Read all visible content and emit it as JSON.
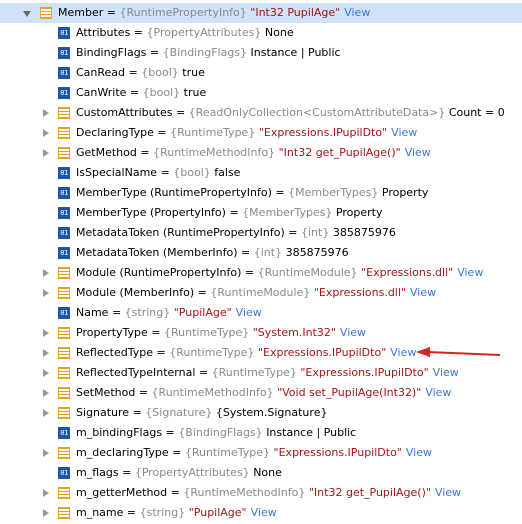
{
  "colors": {
    "selection": "#cfe2f7",
    "property_icon": "#e8a31c",
    "value_icon": "#1f55a8",
    "type_text": "#8a8a8a",
    "string_text": "#a31515",
    "view_link": "#3c78d8",
    "arrow": "#d62424"
  },
  "value_icon_text": "01",
  "equals": " = ",
  "rows": [
    {
      "level": 0,
      "expander": "expanded",
      "icon": "property-icon",
      "selected": true,
      "name": "Member",
      "type": "{RuntimePropertyInfo}",
      "value": "\"Int32 PupilAge\"",
      "value_kind": "string",
      "view": "View"
    },
    {
      "level": 1,
      "expander": "none",
      "icon": "value-icon",
      "name": "Attributes",
      "type": "{PropertyAttributes}",
      "value": "None",
      "value_kind": "plain",
      "view": ""
    },
    {
      "level": 1,
      "expander": "none",
      "icon": "value-icon",
      "name": "BindingFlags",
      "type": "{BindingFlags}",
      "value": "Instance | Public",
      "value_kind": "plain",
      "view": ""
    },
    {
      "level": 1,
      "expander": "none",
      "icon": "value-icon",
      "name": "CanRead",
      "type": "{bool}",
      "value": "true",
      "value_kind": "plain",
      "view": ""
    },
    {
      "level": 1,
      "expander": "none",
      "icon": "value-icon",
      "name": "CanWrite",
      "type": "{bool}",
      "value": "true",
      "value_kind": "plain",
      "view": ""
    },
    {
      "level": 1,
      "expander": "collapsed",
      "icon": "property-icon",
      "name": "CustomAttributes",
      "type": "{ReadOnlyCollection<CustomAttributeData>}",
      "value": "Count = 0",
      "value_kind": "plain",
      "view": ""
    },
    {
      "level": 1,
      "expander": "collapsed",
      "icon": "property-icon",
      "name": "DeclaringType",
      "type": "{RuntimeType}",
      "value": "\"Expressions.IPupilDto\"",
      "value_kind": "string",
      "view": "View"
    },
    {
      "level": 1,
      "expander": "collapsed",
      "icon": "property-icon",
      "name": "GetMethod",
      "type": "{RuntimeMethodInfo}",
      "value": "\"Int32 get_PupilAge()\"",
      "value_kind": "string",
      "view": "View"
    },
    {
      "level": 1,
      "expander": "none",
      "icon": "value-icon",
      "name": "IsSpecialName",
      "type": "{bool}",
      "value": "false",
      "value_kind": "plain",
      "view": ""
    },
    {
      "level": 1,
      "expander": "none",
      "icon": "value-icon",
      "name": "MemberType (RuntimePropertyInfo)",
      "type": "{MemberTypes}",
      "value": "Property",
      "value_kind": "plain",
      "view": ""
    },
    {
      "level": 1,
      "expander": "none",
      "icon": "value-icon",
      "name": "MemberType (PropertyInfo)",
      "type": "{MemberTypes}",
      "value": "Property",
      "value_kind": "plain",
      "view": ""
    },
    {
      "level": 1,
      "expander": "none",
      "icon": "value-icon",
      "name": "MetadataToken (RuntimePropertyInfo)",
      "type": "{int}",
      "value": "385875976",
      "value_kind": "plain",
      "view": ""
    },
    {
      "level": 1,
      "expander": "none",
      "icon": "value-icon",
      "name": "MetadataToken (MemberInfo)",
      "type": "{int}",
      "value": "385875976",
      "value_kind": "plain",
      "view": ""
    },
    {
      "level": 1,
      "expander": "collapsed",
      "icon": "property-icon",
      "name": "Module (RuntimePropertyInfo)",
      "type": "{RuntimeModule}",
      "value": "\"Expressions.dll\"",
      "value_kind": "string",
      "view": "View"
    },
    {
      "level": 1,
      "expander": "collapsed",
      "icon": "property-icon",
      "name": "Module (MemberInfo)",
      "type": "{RuntimeModule}",
      "value": "\"Expressions.dll\"",
      "value_kind": "string",
      "view": "View"
    },
    {
      "level": 1,
      "expander": "none",
      "icon": "value-icon",
      "name": "Name",
      "type": "{string}",
      "value": "\"PupilAge\"",
      "value_kind": "string",
      "view": "View"
    },
    {
      "level": 1,
      "expander": "collapsed",
      "icon": "property-icon",
      "name": "PropertyType",
      "type": "{RuntimeType}",
      "value": "\"System.Int32\"",
      "value_kind": "string",
      "view": "View"
    },
    {
      "level": 1,
      "expander": "collapsed",
      "icon": "property-icon",
      "name": "ReflectedType",
      "type": "{RuntimeType}",
      "value": "\"Expressions.IPupilDto\"",
      "value_kind": "string",
      "view": "View",
      "arrow": true
    },
    {
      "level": 1,
      "expander": "collapsed",
      "icon": "property-icon",
      "name": "ReflectedTypeInternal",
      "type": "{RuntimeType}",
      "value": "\"Expressions.IPupilDto\"",
      "value_kind": "string",
      "view": "View"
    },
    {
      "level": 1,
      "expander": "collapsed",
      "icon": "property-icon",
      "name": "SetMethod",
      "type": "{RuntimeMethodInfo}",
      "value": "\"Void set_PupilAge(Int32)\"",
      "value_kind": "string",
      "view": "View"
    },
    {
      "level": 1,
      "expander": "collapsed",
      "icon": "property-icon",
      "name": "Signature",
      "type": "{Signature}",
      "value": "{System.Signature}",
      "value_kind": "plain",
      "view": ""
    },
    {
      "level": 1,
      "expander": "none",
      "icon": "value-icon",
      "name": "m_bindingFlags",
      "type": "{BindingFlags}",
      "value": "Instance | Public",
      "value_kind": "plain",
      "view": ""
    },
    {
      "level": 1,
      "expander": "collapsed",
      "icon": "property-icon",
      "name": "m_declaringType",
      "type": "{RuntimeType}",
      "value": "\"Expressions.IPupilDto\"",
      "value_kind": "string",
      "view": "View"
    },
    {
      "level": 1,
      "expander": "none",
      "icon": "value-icon",
      "name": "m_flags",
      "type": "{PropertyAttributes}",
      "value": "None",
      "value_kind": "plain",
      "view": ""
    },
    {
      "level": 1,
      "expander": "collapsed",
      "icon": "property-icon",
      "name": "m_getterMethod",
      "type": "{RuntimeMethodInfo}",
      "value": "\"Int32 get_PupilAge()\"",
      "value_kind": "string",
      "view": "View"
    },
    {
      "level": 1,
      "expander": "collapsed",
      "icon": "property-icon",
      "name": "m_name",
      "type": "{string}",
      "value": "\"PupilAge\"",
      "value_kind": "string",
      "view": "View"
    }
  ]
}
